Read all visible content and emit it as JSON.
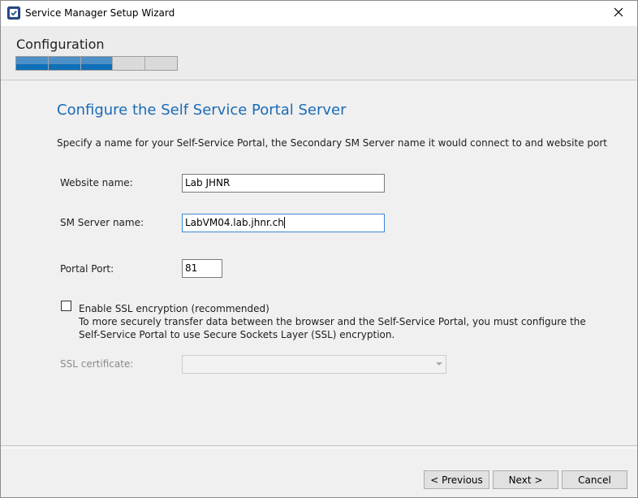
{
  "window": {
    "title": "Service Manager Setup Wizard"
  },
  "header": {
    "title": "Configuration",
    "progress": {
      "completed_segments": 3,
      "total_segments": 5
    }
  },
  "page": {
    "heading": "Configure the Self Service Portal Server",
    "instructions": "Specify a name for your Self-Service Portal, the Secondary SM Server name it would connect to and website port"
  },
  "form": {
    "website_name": {
      "label": "Website name:",
      "value": "Lab JHNR"
    },
    "sm_server_name": {
      "label": "SM Server name:",
      "value": "LabVM04.lab.jhnr.ch"
    },
    "portal_port": {
      "label": "Portal Port:",
      "value": "81"
    },
    "ssl": {
      "checkbox_label": "Enable SSL encryption (recommended)",
      "checked": false,
      "description": "To more securely transfer data between the browser and the Self-Service Portal, you must configure the Self-Service Portal to use Secure Sockets Layer (SSL) encryption."
    },
    "ssl_certificate": {
      "label": "SSL certificate:",
      "value": "",
      "enabled": false
    }
  },
  "buttons": {
    "previous": "< Previous",
    "next": "Next >",
    "cancel": "Cancel"
  },
  "icons": {
    "app": "service-manager-icon",
    "close": "close-icon",
    "dropdown": "chevron-down-icon"
  },
  "colors": {
    "heading": "#1a6bb5",
    "progress_fill": "#0f6fb8",
    "focus_border": "#3c86d4"
  }
}
